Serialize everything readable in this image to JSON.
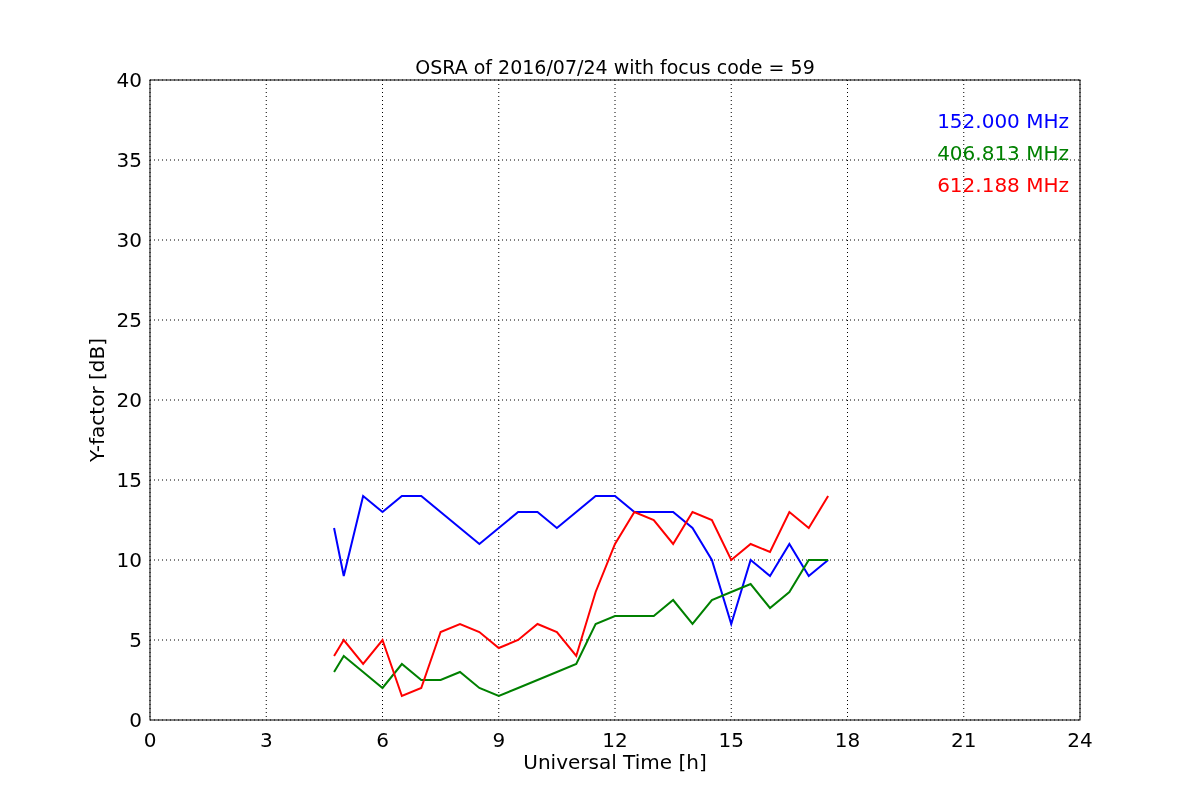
{
  "chart": {
    "chart_data": {
      "type": "line",
      "title": "OSRA of 2016/07/24 with focus code = 59",
      "xlabel": "Universal Time [h]",
      "ylabel": "Y-factor [dB]",
      "x": [
        4.75,
        5,
        5.5,
        6,
        6.5,
        7,
        7.5,
        8,
        8.5,
        9,
        9.5,
        10,
        10.5,
        11,
        11.5,
        12,
        12.5,
        13,
        13.5,
        14,
        14.5,
        15,
        15.5,
        16,
        16.5,
        17,
        17.5
      ],
      "series": [
        {
          "name": "152.000 MHz",
          "color": "#0000ff",
          "values": [
            12,
            9,
            14,
            13,
            14,
            14,
            13,
            12,
            11,
            12,
            13,
            13,
            12,
            13,
            14,
            14,
            13,
            13,
            13,
            12,
            10,
            6,
            10,
            9,
            11,
            9,
            10
          ]
        },
        {
          "name": "406.813 MHz",
          "color": "#008000",
          "values": [
            3,
            4,
            3,
            2,
            3.5,
            2.5,
            2.5,
            3,
            2,
            1.5,
            2,
            2.5,
            3,
            3.5,
            6,
            6.5,
            6.5,
            6.5,
            7.5,
            6,
            7.5,
            8,
            8.5,
            7,
            8,
            10,
            10
          ]
        },
        {
          "name": "612.188 MHz",
          "color": "#ff0000",
          "values": [
            4,
            5,
            3.5,
            5,
            1.5,
            2,
            5.5,
            6,
            5.5,
            4.5,
            5,
            6,
            5.5,
            4,
            8,
            11,
            13,
            12.5,
            11,
            13,
            12.5,
            10,
            11,
            10.5,
            13,
            12,
            14
          ]
        }
      ],
      "grid": true,
      "xlim": [
        0,
        24
      ],
      "ylim": [
        0,
        40
      ],
      "xticks": [
        0,
        3,
        6,
        9,
        12,
        15,
        18,
        21,
        24
      ],
      "yticks": [
        0,
        5,
        10,
        15,
        20,
        25,
        30,
        35,
        40
      ]
    }
  }
}
